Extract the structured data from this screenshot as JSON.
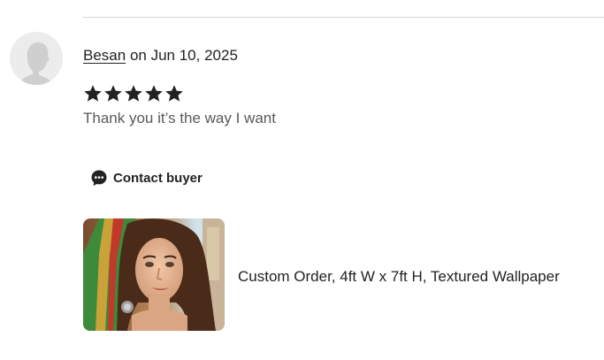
{
  "review": {
    "reviewer_name": "Besan",
    "date_prefix": "on",
    "date": "Jun 10, 2025",
    "rating": 5,
    "max_rating": 5,
    "text": "Thank you it’s the way I want"
  },
  "actions": {
    "contact_label": "Contact buyer"
  },
  "listing": {
    "title": "Custom Order, 4ft W x 7ft H, Textured Wallpaper"
  },
  "colors": {
    "text": "#222222",
    "muted_text": "#595959",
    "divider": "#d6d6d6",
    "avatar_bg": "#eeeeee",
    "avatar_silhouette": "#cfcfcf"
  },
  "icons": {
    "avatar": "default-user-silhouette",
    "star": "filled-star-icon",
    "contact": "chat-bubble-icon"
  }
}
